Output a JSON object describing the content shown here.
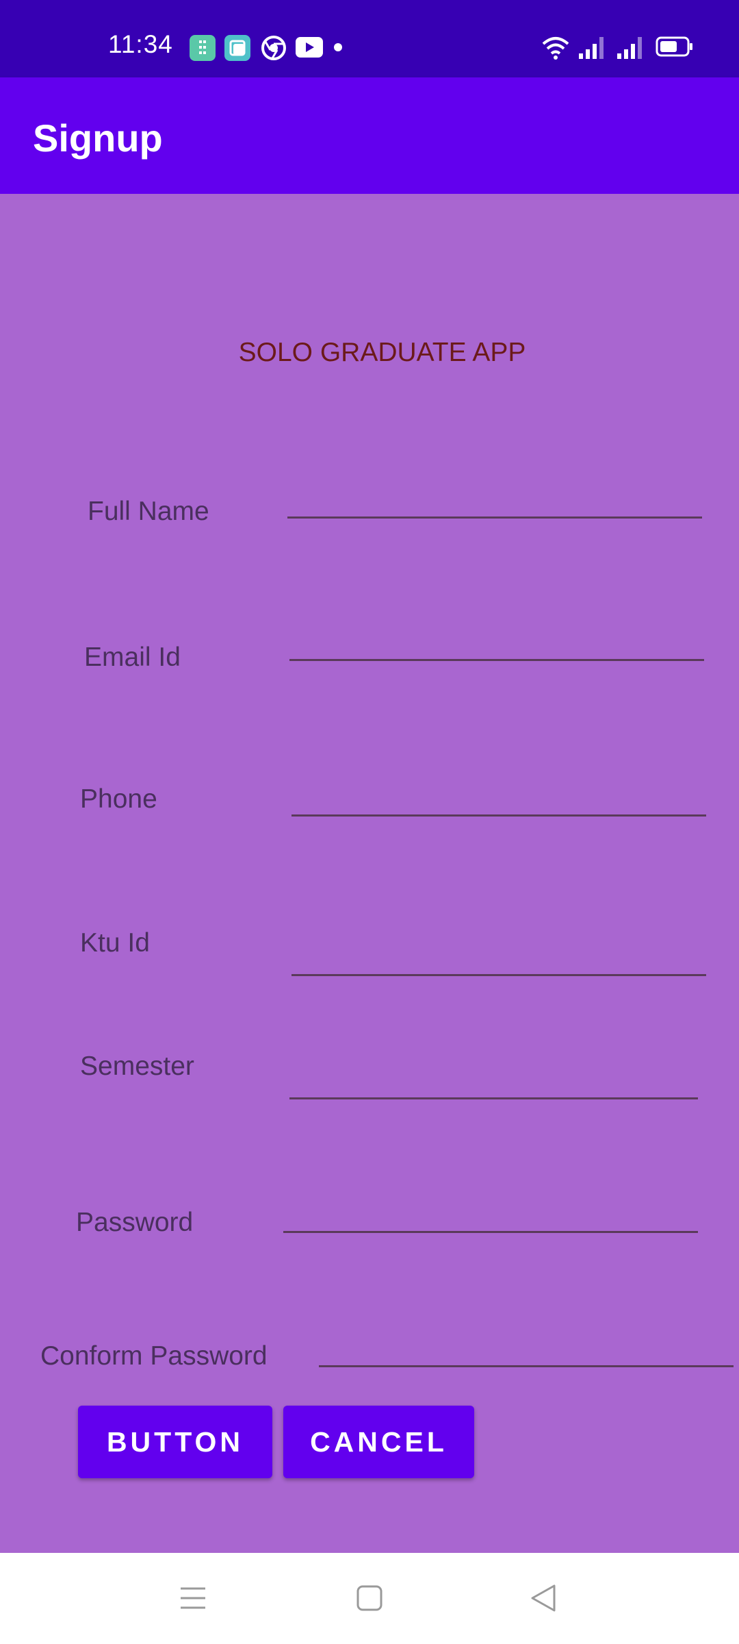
{
  "status_bar": {
    "time": "11:34",
    "icons": [
      "calculator-app-icon",
      "gallery-app-icon",
      "chrome-icon",
      "youtube-icon",
      "notification-dot-icon",
      "wifi-icon",
      "signal-icon",
      "signal-icon",
      "battery-icon"
    ]
  },
  "app_bar": {
    "title": "Signup"
  },
  "form": {
    "heading": "SOLO GRADUATE APP",
    "fields": [
      {
        "label": "Full Name",
        "value": ""
      },
      {
        "label": "Email Id",
        "value": ""
      },
      {
        "label": "Phone",
        "value": ""
      },
      {
        "label": "Ktu Id",
        "value": ""
      },
      {
        "label": "Semester",
        "value": ""
      },
      {
        "label": "Password",
        "value": ""
      },
      {
        "label": "Conform Password",
        "value": ""
      }
    ],
    "buttons": {
      "submit": "BUTTON",
      "cancel": "CANCEL"
    }
  },
  "nav_bar": {
    "icons": [
      "menu-icon",
      "home-icon",
      "back-icon"
    ]
  },
  "colors": {
    "status_bar": "#3700b3",
    "app_bar": "#6200ee",
    "background": "#a966d0",
    "heading_text": "#6b1a1a",
    "label_text": "#4a2f5e",
    "button": "#6200ee"
  }
}
